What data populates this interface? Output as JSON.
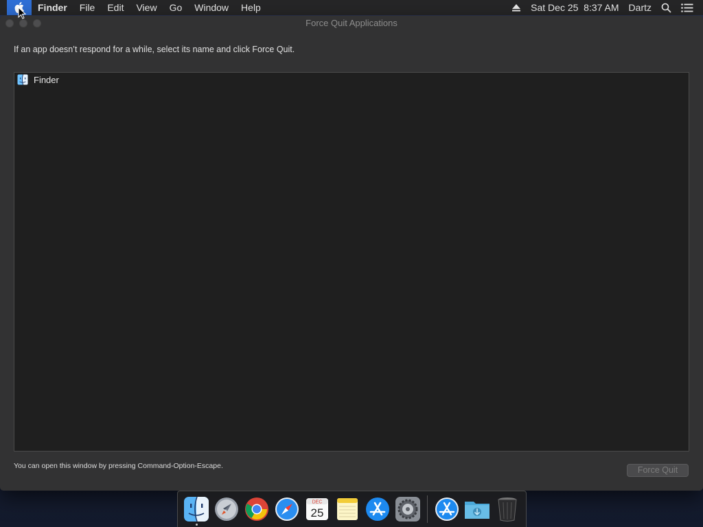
{
  "menubar": {
    "apple_icon": "apple-icon",
    "app_name": "Finder",
    "menus": [
      "File",
      "Edit",
      "View",
      "Go",
      "Window",
      "Help"
    ],
    "datetime": "Sat Dec 25  8:37 AM",
    "user": "Dartz",
    "icons": [
      "eject-icon",
      "search-icon",
      "notification-center-icon"
    ]
  },
  "window": {
    "title": "Force Quit Applications",
    "instructions": "If an app doesn’t respond for a while, select its name and click Force Quit.",
    "apps": [
      {
        "name": "Finder",
        "icon": "finder-icon"
      }
    ],
    "hint": "You can open this window by pressing Command-Option-Escape.",
    "force_quit_label": "Force Quit"
  },
  "dock": {
    "items": [
      "finder-icon",
      "launchpad-icon",
      "chrome-icon",
      "safari-icon",
      "calendar-icon",
      "notes-icon",
      "app-store-icon",
      "system-preferences-icon",
      "app-store-icon",
      "downloads-folder-icon",
      "trash-icon"
    ],
    "calendar_month": "DEC",
    "calendar_day": "25"
  },
  "colors": {
    "menubar_bg": "#262627",
    "apple_highlight": "#2f6fd6",
    "window_bg": "#323233",
    "list_bg": "#1f1f1f"
  }
}
